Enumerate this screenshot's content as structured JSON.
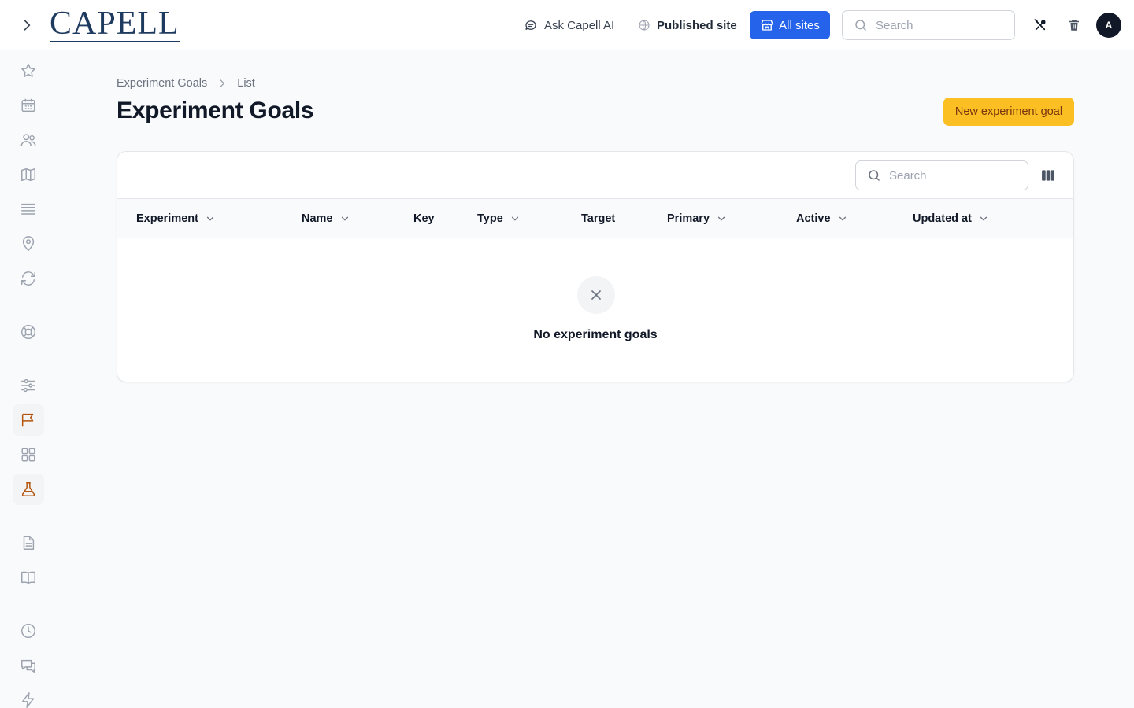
{
  "app": {
    "logo_text": "CAPELL"
  },
  "topbar": {
    "ask_ai_label": "Ask Capell AI",
    "published_site_label": "Published site",
    "all_sites_label": "All sites",
    "search_placeholder": "Search",
    "avatar_initial": "A"
  },
  "breadcrumb": {
    "parent": "Experiment Goals",
    "current": "List"
  },
  "page": {
    "title": "Experiment Goals",
    "new_button_label": "New experiment goal"
  },
  "table": {
    "search_placeholder": "Search",
    "columns": [
      {
        "label": "Experiment",
        "sortable": true
      },
      {
        "label": "Name",
        "sortable": true
      },
      {
        "label": "Key",
        "sortable": false
      },
      {
        "label": "Type",
        "sortable": true
      },
      {
        "label": "Target",
        "sortable": false
      },
      {
        "label": "Primary",
        "sortable": true
      },
      {
        "label": "Active",
        "sortable": true
      },
      {
        "label": "Updated at",
        "sortable": true
      }
    ],
    "empty_message": "No experiment goals"
  },
  "sidebar": {
    "items": [
      {
        "icon": "star-icon"
      },
      {
        "icon": "calendar-icon"
      },
      {
        "icon": "users-icon"
      },
      {
        "icon": "map-icon"
      },
      {
        "icon": "list-icon"
      },
      {
        "icon": "map-pin-icon"
      },
      {
        "icon": "refresh-icon"
      },
      {
        "icon": "lifebuoy-icon"
      },
      {
        "icon": "sliders-icon"
      },
      {
        "icon": "flag-icon",
        "active": true
      },
      {
        "icon": "grid-icon"
      },
      {
        "icon": "beaker-icon",
        "active": true
      },
      {
        "icon": "document-icon"
      },
      {
        "icon": "book-icon"
      },
      {
        "icon": "clock-icon"
      },
      {
        "icon": "chat-icon"
      },
      {
        "icon": "bolt-icon"
      }
    ]
  },
  "colors": {
    "primary_blue": "#2563eb",
    "accent_amber": "#fbbf24",
    "active_icon": "#b45309",
    "icon_gray": "#9ca3af"
  }
}
